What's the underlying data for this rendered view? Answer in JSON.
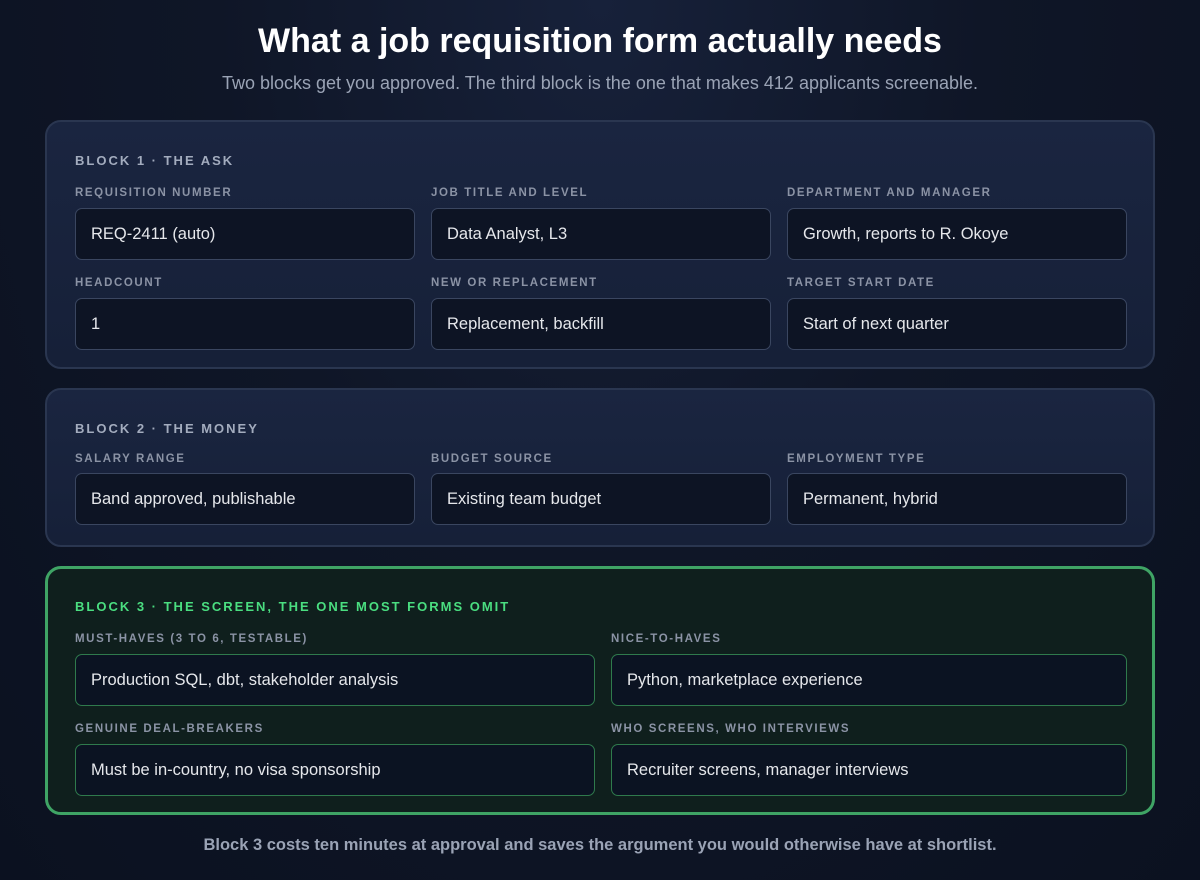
{
  "header": {
    "title": "What a job requisition form actually needs",
    "subtitle": "Two blocks get you approved. The third block is the one that makes 412 applicants screenable."
  },
  "block1": {
    "title": "BLOCK 1 · THE ASK",
    "fields": [
      {
        "label": "REQUISITION NUMBER",
        "value": "REQ-2411 (auto)"
      },
      {
        "label": "JOB TITLE AND LEVEL",
        "value": "Data Analyst, L3"
      },
      {
        "label": "DEPARTMENT AND MANAGER",
        "value": "Growth, reports to R. Okoye"
      },
      {
        "label": "HEADCOUNT",
        "value": "1"
      },
      {
        "label": "NEW OR REPLACEMENT",
        "value": "Replacement, backfill"
      },
      {
        "label": "TARGET START DATE",
        "value": "Start of next quarter"
      }
    ]
  },
  "block2": {
    "title": "BLOCK 2 · THE MONEY",
    "fields": [
      {
        "label": "SALARY RANGE",
        "value": "Band approved, publishable"
      },
      {
        "label": "BUDGET SOURCE",
        "value": "Existing team budget"
      },
      {
        "label": "EMPLOYMENT TYPE",
        "value": "Permanent, hybrid"
      }
    ]
  },
  "block3": {
    "title": "BLOCK 3 · THE SCREEN, THE ONE MOST FORMS OMIT",
    "fields": [
      {
        "label": "MUST-HAVES (3 TO 6, TESTABLE)",
        "value": "Production SQL, dbt, stakeholder analysis"
      },
      {
        "label": "NICE-TO-HAVES",
        "value": "Python, marketplace experience"
      },
      {
        "label": "GENUINE DEAL-BREAKERS",
        "value": "Must be in-country, no visa sponsorship"
      },
      {
        "label": "WHO SCREENS, WHO INTERVIEWS",
        "value": "Recruiter screens, manager interviews"
      }
    ]
  },
  "footer": {
    "note": "Block 3 costs ten minutes at approval and saves the argument you would otherwise have at shortlist."
  },
  "colors": {
    "accent_green": "#4ade80",
    "block3_border": "#3fa465",
    "background": "#0f1627"
  }
}
